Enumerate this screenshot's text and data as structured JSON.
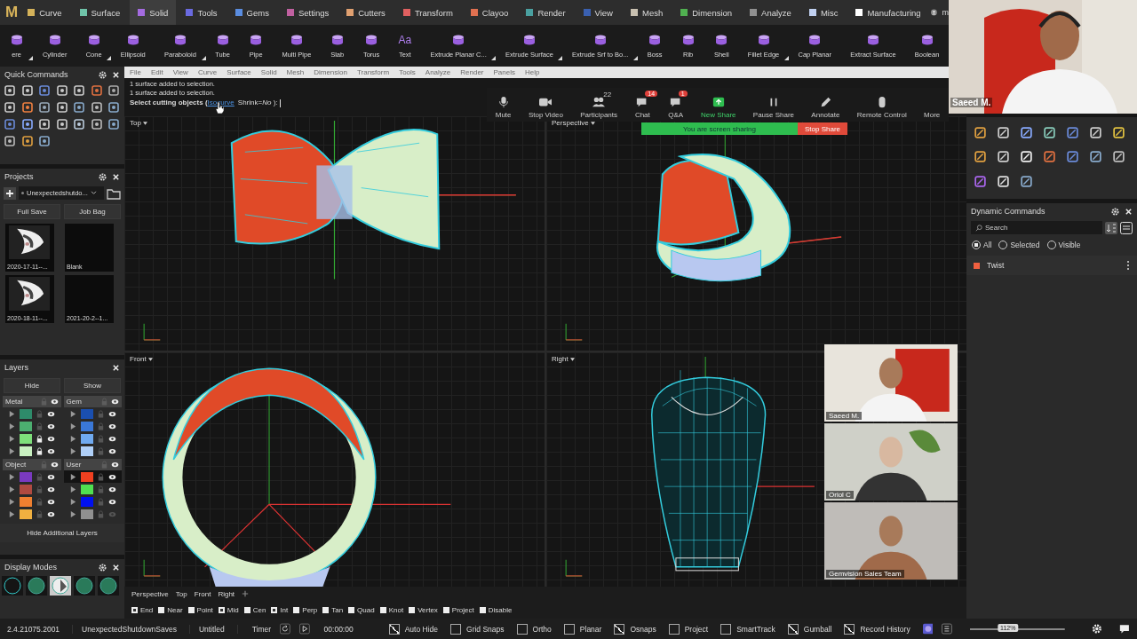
{
  "logo": "M",
  "ribbon_tabs": [
    {
      "label": "Curve",
      "color": "#d4b25a",
      "selected": false
    },
    {
      "label": "Surface",
      "color": "#6fc2a8",
      "selected": false
    },
    {
      "label": "Solid",
      "color": "#a46be0",
      "selected": true
    },
    {
      "label": "Tools",
      "color": "#6a6ae0",
      "selected": false
    },
    {
      "label": "Gems",
      "color": "#5a8de0",
      "selected": false
    },
    {
      "label": "Settings",
      "color": "#c060a0",
      "selected": false
    },
    {
      "label": "Cutters",
      "color": "#e0a070",
      "selected": false
    },
    {
      "label": "Transform",
      "color": "#e06060",
      "selected": false
    },
    {
      "label": "Clayoo",
      "color": "#e07050",
      "selected": false
    },
    {
      "label": "Render",
      "color": "#4aa0a0",
      "selected": false
    },
    {
      "label": "View",
      "color": "#3a60b0",
      "selected": false
    },
    {
      "label": "Mesh",
      "color": "#c8c0b0",
      "selected": false
    },
    {
      "label": "Dimension",
      "color": "#50b050",
      "selected": false
    },
    {
      "label": "Analyze",
      "color": "#909090",
      "selected": false
    },
    {
      "label": "Misc",
      "color": "#c0d0f0",
      "selected": false
    },
    {
      "label": "Manufacturing",
      "color": "#ffffff",
      "selected": false
    }
  ],
  "user": "m",
  "tools": [
    {
      "label": "ere",
      "has_menu": true
    },
    {
      "label": "Cylinder",
      "has_menu": false
    },
    {
      "label": "Cone",
      "has_menu": true
    },
    {
      "label": "Ellipsoid",
      "has_menu": false
    },
    {
      "label": "Paraboloid",
      "has_menu": true
    },
    {
      "label": "Tube",
      "has_menu": false
    },
    {
      "label": "Pipe",
      "has_menu": false
    },
    {
      "label": "Multi Pipe",
      "has_menu": false
    },
    {
      "label": "Slab",
      "has_menu": false
    },
    {
      "label": "Torus",
      "has_menu": false
    },
    {
      "label": "Text",
      "glyph": "Aa",
      "has_menu": false
    },
    {
      "label": "Extrude Planar C...",
      "has_menu": true
    },
    {
      "label": "Extrude Surface",
      "has_menu": true
    },
    {
      "label": "Extrude Srf to Bo...",
      "has_menu": true
    },
    {
      "label": "Boss",
      "has_menu": false
    },
    {
      "label": "Rib",
      "has_menu": false
    },
    {
      "label": "Shell",
      "has_menu": false
    },
    {
      "label": "Fillet Edge",
      "has_menu": true
    },
    {
      "label": "Cap Planar",
      "has_menu": false
    },
    {
      "label": "Extract Surface",
      "has_menu": false
    },
    {
      "label": "Boolean",
      "has_menu": false
    }
  ],
  "quick_commands": {
    "title": "Quick Commands"
  },
  "projects": {
    "title": "Projects",
    "project": "Unexpectedshutdo...",
    "buttons": [
      "Full Save",
      "Job Bag"
    ],
    "thumbnails": [
      {
        "label": "2020-17-11--...",
        "kind": "picture"
      },
      {
        "label": "Blank",
        "kind": "blank"
      },
      {
        "label": "2020-18-11--...",
        "kind": "picture"
      },
      {
        "label": "2021-20-2--1...",
        "kind": "blank"
      }
    ]
  },
  "layers": {
    "title": "Layers",
    "hide": "Hide",
    "show": "Show",
    "groups": [
      {
        "name": "Metal",
        "layers": [
          {
            "color": "#2e8b6a",
            "locked": false,
            "visible": true,
            "current": false
          },
          {
            "color": "#4caf70",
            "locked": false,
            "visible": true,
            "current": false
          },
          {
            "color": "#7ee07a",
            "locked": true,
            "visible": true,
            "current": false
          },
          {
            "color": "#c8f0c0",
            "locked": true,
            "visible": true,
            "current": false
          }
        ]
      },
      {
        "name": "Gem",
        "layers": [
          {
            "color": "#1a4fb0",
            "locked": false,
            "visible": true,
            "current": false
          },
          {
            "color": "#3a78d8",
            "locked": false,
            "visible": true,
            "current": false
          },
          {
            "color": "#70aaf0",
            "locked": false,
            "visible": true,
            "current": false
          },
          {
            "color": "#b0d0f8",
            "locked": false,
            "visible": true,
            "current": false
          }
        ]
      },
      {
        "name": "Object",
        "layers": [
          {
            "color": "#7a3ac0",
            "locked": false,
            "visible": true,
            "current": false
          },
          {
            "color": "#b04a40",
            "locked": false,
            "visible": true,
            "current": false
          },
          {
            "color": "#f08030",
            "locked": false,
            "visible": true,
            "current": false
          },
          {
            "color": "#f0b040",
            "locked": false,
            "visible": true,
            "current": false
          }
        ]
      },
      {
        "name": "User",
        "layers": [
          {
            "color": "#f04020",
            "locked": false,
            "visible": true,
            "current": true
          },
          {
            "color": "#50e050",
            "locked": false,
            "visible": true,
            "current": false
          },
          {
            "color": "#0010f0",
            "locked": false,
            "visible": true,
            "current": false
          },
          {
            "color": "#909090",
            "locked": false,
            "visible": false,
            "current": false
          }
        ]
      }
    ],
    "more": "Hide Additional Layers"
  },
  "display_modes": {
    "title": "Display Modes"
  },
  "menu_bar": [
    "File",
    "Edit",
    "View",
    "Curve",
    "Surface",
    "Solid",
    "Mesh",
    "Dimension",
    "Transform",
    "Tools",
    "Analyze",
    "Render",
    "Panels",
    "Help"
  ],
  "command_history": [
    "1 surface added to selection.",
    "1 surface added to selection."
  ],
  "prompt": {
    "text": "Select cutting objects (",
    "option": "Isocurve",
    "rest": "Shrink=*No* ):"
  },
  "viewports": [
    {
      "label": "Top",
      "kind": "twist-top"
    },
    {
      "label": "Perspective",
      "kind": "twist-perspective"
    },
    {
      "label": "Front",
      "kind": "ring-front"
    },
    {
      "label": "Right",
      "kind": "ring-right"
    }
  ],
  "view_tabs": [
    "Perspective",
    "Top",
    "Front",
    "Right"
  ],
  "osnaps": [
    {
      "label": "End",
      "checked": true
    },
    {
      "label": "Near",
      "checked": false
    },
    {
      "label": "Point",
      "checked": false
    },
    {
      "label": "Mid",
      "checked": true
    },
    {
      "label": "Cen",
      "checked": false
    },
    {
      "label": "Int",
      "checked": true
    },
    {
      "label": "Perp",
      "checked": false
    },
    {
      "label": "Tan",
      "checked": false
    },
    {
      "label": "Quad",
      "checked": false
    },
    {
      "label": "Knot",
      "checked": false
    },
    {
      "label": "Vertex",
      "checked": false
    },
    {
      "label": "Project",
      "checked": false
    },
    {
      "label": "Disable",
      "checked": false
    }
  ],
  "status_bar": {
    "version": "2.4.21075.2001",
    "folder": "UnexpectedShutdownSaves",
    "file": "Untitled",
    "timer": "Timer",
    "time": "00:00:00",
    "toggles": [
      {
        "label": "Auto Hide",
        "checked": true
      },
      {
        "label": "Grid Snaps",
        "checked": false
      },
      {
        "label": "Ortho",
        "checked": false
      },
      {
        "label": "Planar",
        "checked": false
      },
      {
        "label": "Osnaps",
        "checked": true
      },
      {
        "label": "Project",
        "checked": false
      },
      {
        "label": "SmartTrack",
        "checked": false
      },
      {
        "label": "Gumball",
        "checked": true
      },
      {
        "label": "Record History",
        "checked": true
      }
    ],
    "zoom": "112%",
    "level": 0.4
  },
  "dynamic_commands": {
    "title": "Dynamic Commands",
    "search": {
      "placeholder": "Search"
    },
    "filters": [
      {
        "label": "All",
        "selected": true
      },
      {
        "label": "Selected",
        "selected": false
      },
      {
        "label": "Visible",
        "selected": false
      }
    ],
    "items": [
      {
        "label": "Twist",
        "color": "#f06040"
      }
    ]
  },
  "meeting": {
    "controls": [
      {
        "kind": "mute",
        "label": "Mute",
        "accent": false
      },
      {
        "kind": "video",
        "label": "Stop Video",
        "accent": false
      },
      {
        "kind": "participants",
        "label": "Participants",
        "count": "22",
        "accent": false
      },
      {
        "kind": "chat",
        "label": "Chat",
        "badge": "14",
        "accent": false
      },
      {
        "kind": "qa",
        "label": "Q&A",
        "badge": "1",
        "accent": false
      },
      {
        "kind": "share",
        "label": "New Share",
        "accent": true
      },
      {
        "kind": "pause",
        "label": "Pause Share",
        "accent": false
      },
      {
        "kind": "annotate",
        "label": "Annotate",
        "accent": false
      },
      {
        "kind": "remote",
        "label": "Remote Control",
        "accent": false
      },
      {
        "kind": "more",
        "label": "More",
        "accent": false
      }
    ],
    "banner": "You are screen sharing",
    "stop": "Stop Share",
    "speaker": {
      "name": "Saeed M.",
      "kind": "picture"
    },
    "tiles": [
      {
        "name": "Saeed M.",
        "kind": "picture"
      },
      {
        "name": "Oriol C",
        "kind": "picture"
      },
      {
        "name": "Gemvision Sales Team",
        "kind": "picture"
      }
    ]
  }
}
